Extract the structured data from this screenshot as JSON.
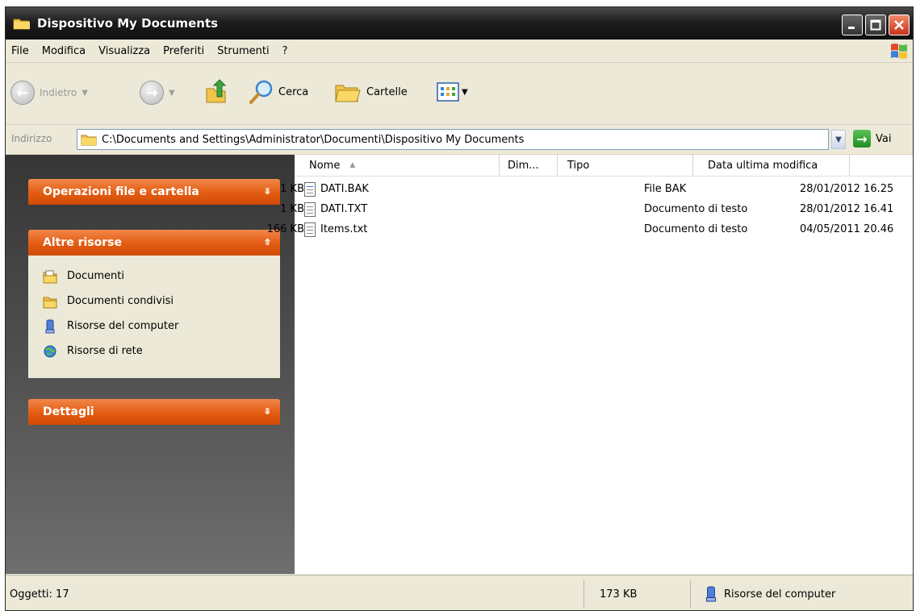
{
  "window": {
    "title": "Dispositivo My Documents"
  },
  "menu": [
    "File",
    "Modifica",
    "Visualizza",
    "Preferiti",
    "Strumenti",
    "?"
  ],
  "toolbar": {
    "back_label": "Indietro",
    "search_label": "Cerca",
    "folders_label": "Cartelle"
  },
  "address": {
    "label": "Indirizzo",
    "path": "C:\\Documents and Settings\\Administrator\\Documenti\\Dispositivo My Documents",
    "go_label": "Vai"
  },
  "sidebar": {
    "pane1_title": "Operazioni file e cartella",
    "pane2_title": "Altre risorse",
    "pane2_links": [
      "Documenti",
      "Documenti condivisi",
      "Risorse del computer",
      "Risorse di rete"
    ],
    "pane3_title": "Dettagli"
  },
  "columns": {
    "name": "Nome",
    "size": "Dim...",
    "type": "Tipo",
    "modified": "Data ultima modifica"
  },
  "files": [
    {
      "name": "DATI.BAK",
      "size": "1 KB",
      "type": "File BAK",
      "modified": "28/01/2012 16.25",
      "icon": "bak-file-icon"
    },
    {
      "name": "DATI.TXT",
      "size": "1 KB",
      "type": "Documento di testo",
      "modified": "28/01/2012 16.41",
      "icon": "text-file-icon"
    },
    {
      "name": "Items.txt",
      "size": "166 KB",
      "type": "Documento di testo",
      "modified": "04/05/2011 20.46",
      "icon": "text-file-icon"
    }
  ],
  "status": {
    "objects": "Oggetti: 17",
    "size": "173 KB",
    "location": "Risorse del computer"
  },
  "colors": {
    "titlebar": "#1e1e1e",
    "pane_header": "#e45c12",
    "panel_bg": "#4a4a4a",
    "window_bg": "#ece9d8"
  }
}
